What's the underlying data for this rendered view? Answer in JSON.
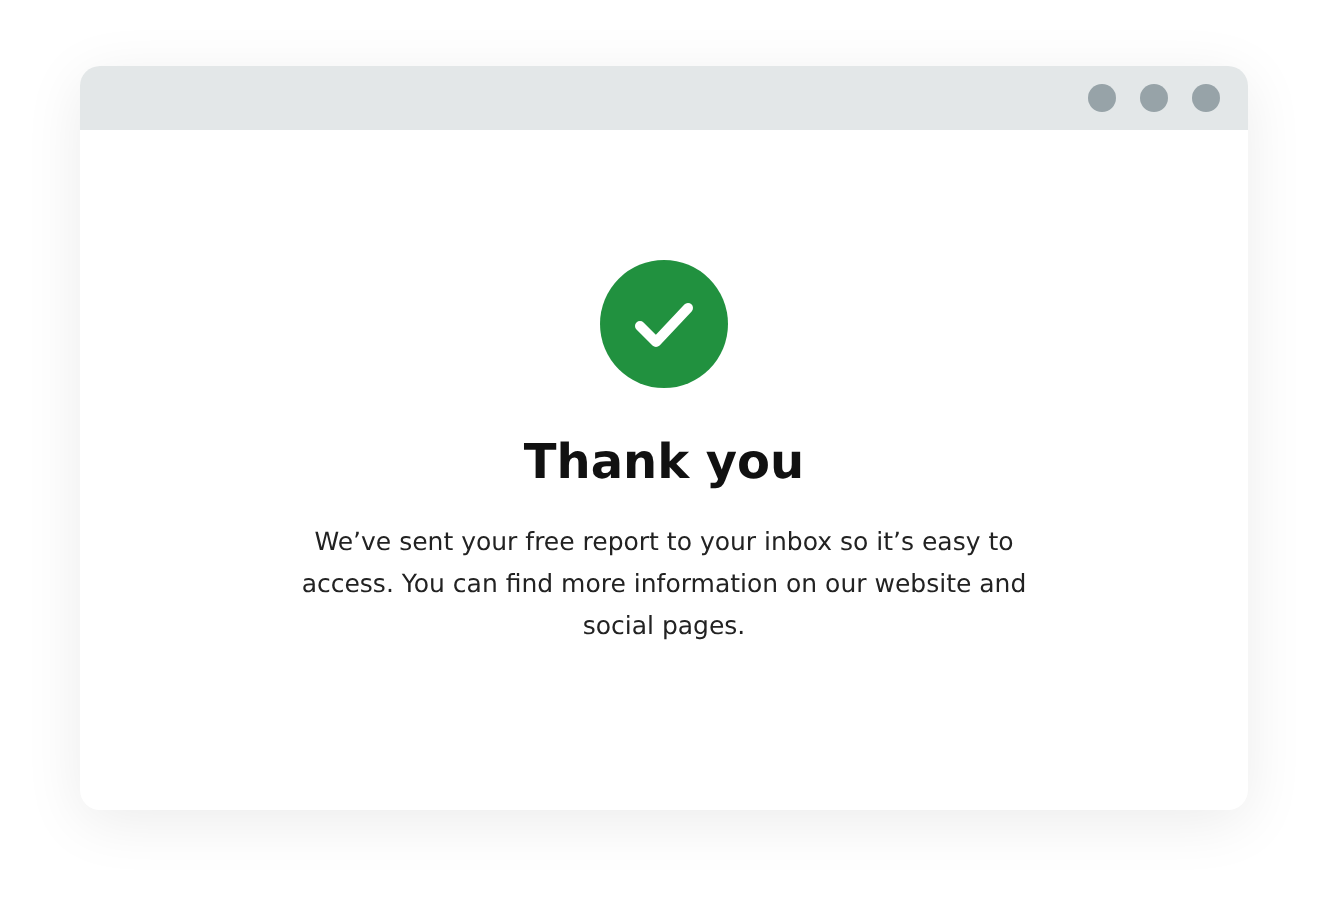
{
  "heading": "Thank you",
  "message": "We’ve sent your free report to your inbox so it’s easy to access. You can find more information on our website and social pages."
}
